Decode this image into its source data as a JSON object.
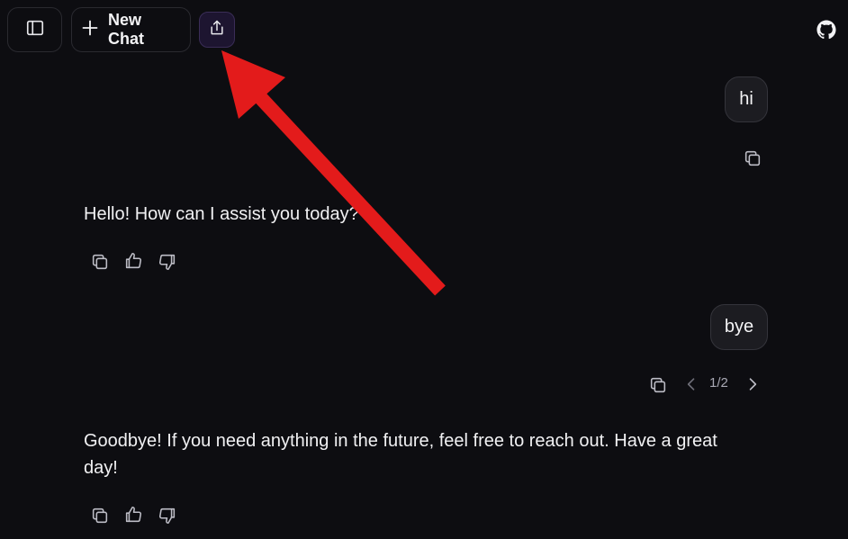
{
  "toolbar": {
    "new_chat_label": "New Chat",
    "icons": [
      "sidebar-toggle-icon",
      "plus-icon",
      "share-icon",
      "github-icon"
    ]
  },
  "messages": [
    {
      "role": "user",
      "text": "hi"
    },
    {
      "role": "assistant",
      "text": "Hello! How can I assist you today?"
    },
    {
      "role": "user",
      "text": "bye",
      "pager": "1/2"
    },
    {
      "role": "assistant",
      "text": "Goodbye! If you need anything in the future, feel free to reach out. Have a great day!"
    }
  ],
  "colors": {
    "background": "#0d0d11",
    "bubble": "#1c1c21",
    "share_button": "#1d1530",
    "annotation_arrow": "#e31b1b"
  }
}
